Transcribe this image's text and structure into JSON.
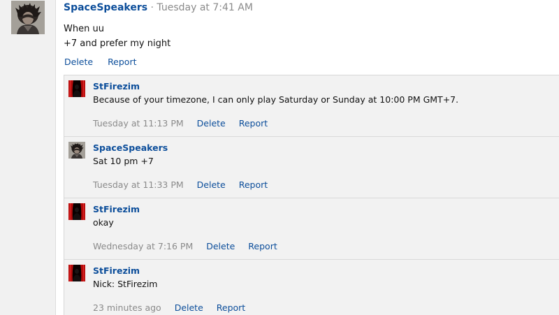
{
  "post": {
    "author": "SpaceSpeakers",
    "separator": "·",
    "time": "Tuesday at 7:41 AM",
    "lines": [
      "When uu",
      "+7 and prefer my night"
    ],
    "avatar_icon": "user-avatar-photo",
    "actions": {
      "delete": "Delete",
      "report": "Report"
    }
  },
  "replies": [
    {
      "author": "StFirezim",
      "avatar_icon": "red-curtain-avatar",
      "text": "Because of your timezone, I can only play Saturday or Sunday at 10:00 PM GMT+7.",
      "time": "Tuesday at 11:13 PM",
      "delete": "Delete",
      "report": "Report"
    },
    {
      "author": "SpaceSpeakers",
      "avatar_icon": "user-avatar-photo",
      "text": "Sat 10 pm +7",
      "time": "Tuesday at 11:33 PM",
      "delete": "Delete",
      "report": "Report"
    },
    {
      "author": "StFirezim",
      "avatar_icon": "red-curtain-avatar",
      "text": "okay",
      "time": "Wednesday at 7:16 PM",
      "delete": "Delete",
      "report": "Report"
    },
    {
      "author": "StFirezim",
      "avatar_icon": "red-curtain-avatar",
      "text": "Nick: StFirezim",
      "time": "23 minutes ago",
      "delete": "Delete",
      "report": "Report"
    }
  ],
  "colors": {
    "link": "#0b4d9a",
    "muted": "#8a8a8a",
    "reply_bg": "#f2f2f2",
    "gutter_bg": "#f1f1f1"
  }
}
